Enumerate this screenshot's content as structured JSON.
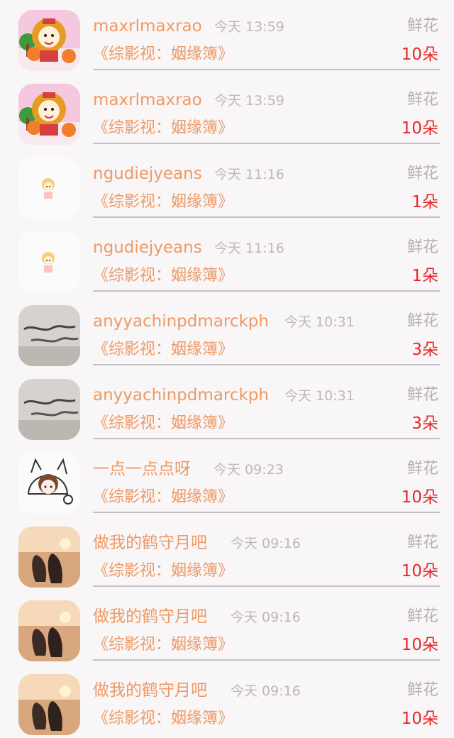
{
  "gift_items": [
    {
      "avatar_icon": "lion-cartoon-avatar",
      "username": "maxrlmaxrao",
      "time": "今天 13:59",
      "gift_label": "鲜花",
      "book_title": "《综影视：姻缘簿》",
      "count": "10朵"
    },
    {
      "avatar_icon": "lion-cartoon-avatar",
      "username": "maxrlmaxrao",
      "time": "今天 13:59",
      "gift_label": "鲜花",
      "book_title": "《综影视：姻缘簿》",
      "count": "10朵"
    },
    {
      "avatar_icon": "tiny-doll-avatar",
      "username": "ngudiejyeans",
      "time": "今天 11:16",
      "gift_label": "鲜花",
      "book_title": "《综影视：姻缘簿》",
      "count": "1朵"
    },
    {
      "avatar_icon": "tiny-doll-avatar",
      "username": "ngudiejyeans",
      "time": "今天 11:16",
      "gift_label": "鲜花",
      "book_title": "《综影视：姻缘簿》",
      "count": "1朵"
    },
    {
      "avatar_icon": "handwriting-note-avatar",
      "username": "anyyachinpdmarckph",
      "time": "今天 10:31",
      "gift_label": "鲜花",
      "book_title": "《综影视：姻缘簿》",
      "count": "3朵"
    },
    {
      "avatar_icon": "handwriting-note-avatar",
      "username": "anyyachinpdmarckph",
      "time": "今天 10:31",
      "gift_label": "鲜花",
      "book_title": "《综影视：姻缘簿》",
      "count": "3朵"
    },
    {
      "avatar_icon": "sketch-cat-hood-avatar",
      "username": "一点一点点呀",
      "time": "今天 09:23",
      "gift_label": "鲜花",
      "book_title": "《综影视：姻缘簿》",
      "count": "10朵"
    },
    {
      "avatar_icon": "sunset-couple-avatar",
      "username": "做我的鹤守月吧",
      "time": "今天 09:16",
      "gift_label": "鲜花",
      "book_title": "《综影视：姻缘簿》",
      "count": "10朵"
    },
    {
      "avatar_icon": "sunset-couple-avatar",
      "username": "做我的鹤守月吧",
      "time": "今天 09:16",
      "gift_label": "鲜花",
      "book_title": "《综影视：姻缘簿》",
      "count": "10朵"
    },
    {
      "avatar_icon": "sunset-couple-avatar",
      "username": "做我的鹤守月吧",
      "time": "今天 09:16",
      "gift_label": "鲜花",
      "book_title": "《综影视：姻缘簿》",
      "count": "10朵"
    }
  ]
}
